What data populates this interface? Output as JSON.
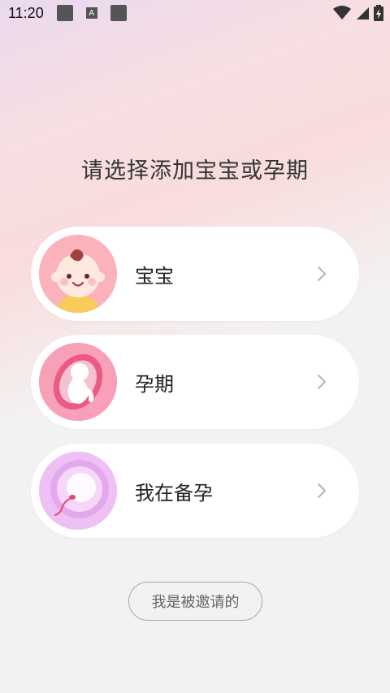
{
  "status_bar": {
    "time": "11:20",
    "icons": [
      "notification-square-icon",
      "a-badge-icon",
      "notification-square-icon",
      "wifi-icon",
      "signal-icon",
      "battery-charging-icon"
    ],
    "a_badge": "A"
  },
  "title": "请选择添加宝宝或孕期",
  "options": [
    {
      "label": "宝宝",
      "icon": "baby-face-icon",
      "colors": {
        "bg": "#f9a6b0"
      }
    },
    {
      "label": "孕期",
      "icon": "fetus-icon",
      "colors": {
        "bg": "#f58aa8"
      }
    },
    {
      "label": "我在备孕",
      "icon": "egg-sperm-icon",
      "colors": {
        "bg": "#eab8f2"
      }
    }
  ],
  "invite_button": "我是被邀请的",
  "colors": {
    "card_bg": "#ffffff",
    "chevron": "#b5b5b5",
    "page_bg": "#f3f2f2"
  }
}
